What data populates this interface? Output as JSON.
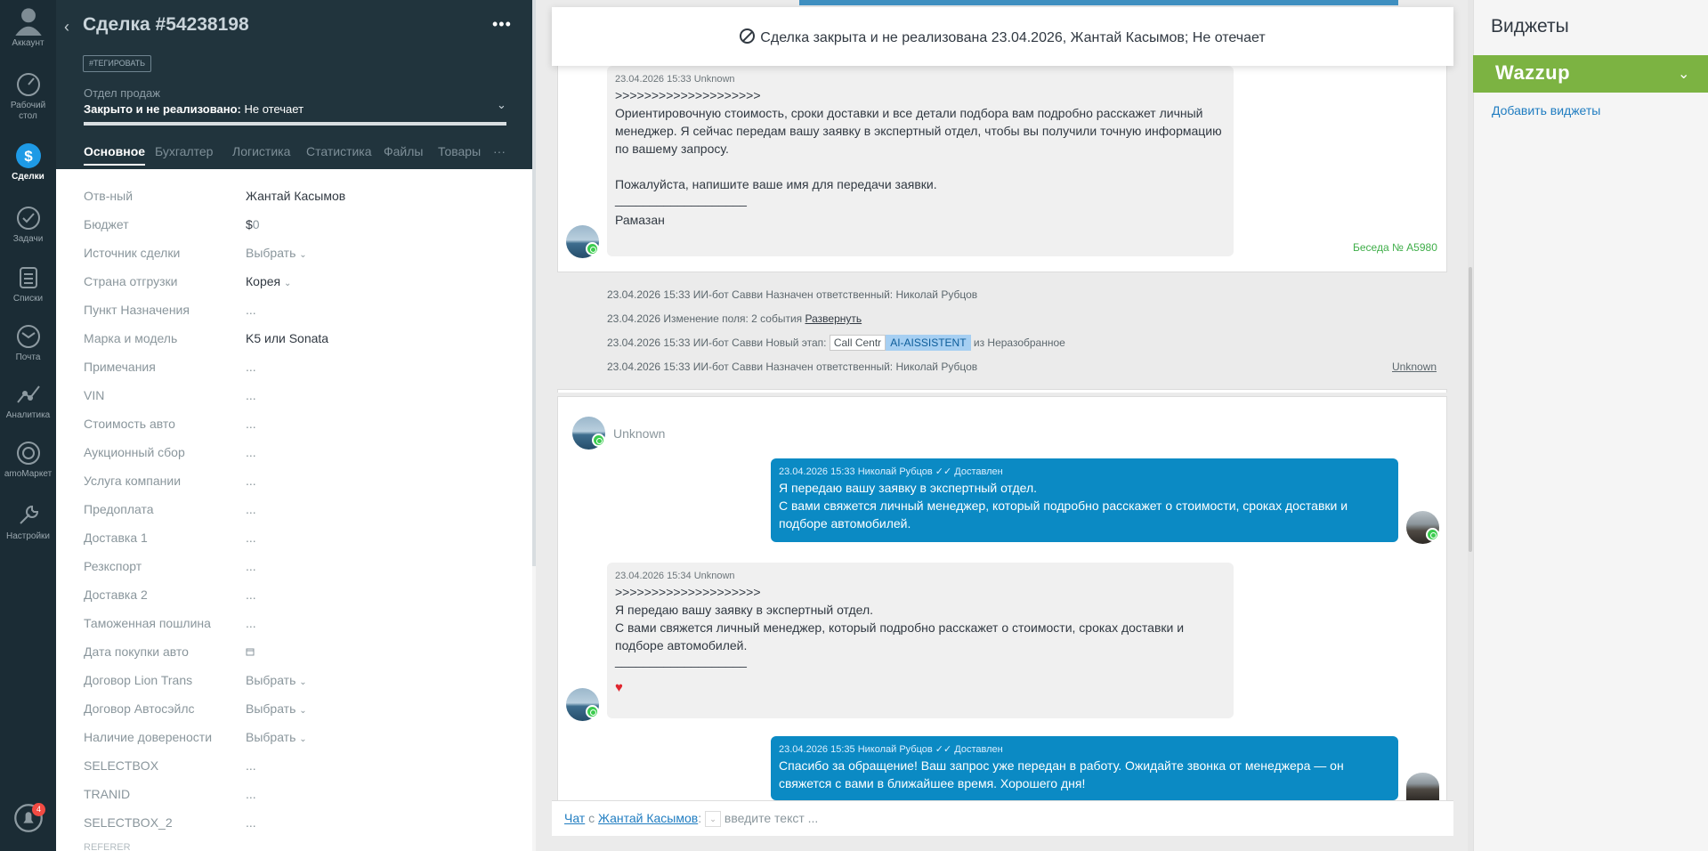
{
  "nav": {
    "items": [
      {
        "label": "Аккаунт",
        "icon": "account-icon"
      },
      {
        "label": "Рабочий стол",
        "icon": "dashboard-icon"
      },
      {
        "label": "Сделки",
        "icon": "deals-icon"
      },
      {
        "label": "Задачи",
        "icon": "tasks-icon"
      },
      {
        "label": "Списки",
        "icon": "lists-icon"
      },
      {
        "label": "Почта",
        "icon": "mail-icon"
      },
      {
        "label": "Аналитика",
        "icon": "analytics-icon"
      },
      {
        "label": "amoМаркет",
        "icon": "market-icon"
      },
      {
        "label": "Настройки",
        "icon": "settings-icon"
      }
    ],
    "notification_count": "4"
  },
  "card": {
    "title": "Сделка #54238198",
    "tag_button": "#ТЕГИРОВАТЬ",
    "pipeline": "Отдел продаж",
    "status_bold": "Закрыто и не реализовано:",
    "status_reason": "Не отечает",
    "tabs": [
      "Основное",
      "Бухгалтер",
      "Логистика",
      "Статистика",
      "Файлы",
      "Товары"
    ],
    "tab_more": "···",
    "fields": [
      {
        "label": "Отв-ный",
        "value": "Жантай Касымов"
      },
      {
        "label": "Бюджет",
        "value": "$",
        "value2": "0"
      },
      {
        "label": "Источник сделки",
        "value": "Выбрать"
      },
      {
        "label": "Страна отгрузки",
        "value": "Корея"
      },
      {
        "label": "Пункт Назначения",
        "value": "..."
      },
      {
        "label": "Марка и модель",
        "value": "K5 или Sonata"
      },
      {
        "label": "Примечания",
        "value": "..."
      },
      {
        "label": "VIN",
        "value": "..."
      },
      {
        "label": "Стоимость авто",
        "value": "..."
      },
      {
        "label": "Аукционный сбор",
        "value": "..."
      },
      {
        "label": "Услуга компании",
        "value": "..."
      },
      {
        "label": "Предоплата",
        "value": "..."
      },
      {
        "label": "Доставка 1",
        "value": "..."
      },
      {
        "label": "Резкспорт",
        "value": "..."
      },
      {
        "label": "Доставка 2",
        "value": "..."
      },
      {
        "label": "Таможенная пошлина",
        "value": "..."
      },
      {
        "label": "Дата покупки авто",
        "value": ""
      },
      {
        "label": "Договор Lion Trans",
        "value": "Выбрать"
      },
      {
        "label": "Договор Автосэйлс",
        "value": "Выбрать"
      },
      {
        "label": "Наличие доверености",
        "value": "Выбрать"
      },
      {
        "label": "SELECTBOX",
        "value": "..."
      },
      {
        "label": "TRANID",
        "value": "..."
      },
      {
        "label": "SELECTBOX_2",
        "value": "..."
      },
      {
        "label": "REFERER",
        "value": ""
      }
    ]
  },
  "feed": {
    "closed_banner": "Сделка закрыта и не реализована 23.04.2026, Жантай Касымов; Не отечает",
    "msg1": {
      "meta": "23.04.2026 15:33 Unknown",
      "arrows": ">>>>>>>>>>>>>>>>>>>>",
      "text1": "Ориентировочную стоимость, сроки доставки и все детали подбора вам подробно расскажет личный менеджер. Я сейчас передам вашу заявку в экспертный отдел, чтобы вы получили точную информацию по вашему запросу.",
      "text2": "Пожалуйста, напишите ваше имя для передачи заявки.",
      "line": "___________________",
      "sign": "Рамазан"
    },
    "conversation_label": "Беседа № А5980",
    "events": [
      {
        "text": "23.04.2026 15:33 ИИ-бот Савви Назначен ответственный: Николай Рубцов"
      },
      {
        "text": "23.04.2026 Изменение поля: 2 события ",
        "link": "Развернуть"
      },
      {
        "text": "23.04.2026 15:33 ИИ-бот Савви Новый этап: ",
        "pill1": "Call Centr",
        "pill2": "AI-AISSISTENT",
        "tail": " из Неразобранное"
      },
      {
        "text": "23.04.2026 15:33 ИИ-бот Савви Назначен ответственный: Николай Рубцов",
        "right": "Unknown"
      }
    ],
    "chat2_header": "Unknown",
    "msg_out1": {
      "meta": "23.04.2026 15:33 Николай Рубцов",
      "status": "Доставлен",
      "line1": "Я передаю вашу заявку в экспертный отдел.",
      "line2": "С вами свяжется личный менеджер, который подробно расскажет о стоимости, сроках доставки и подборе автомобилей."
    },
    "msg_in2": {
      "meta": "23.04.2026 15:34 Unknown",
      "arrows": ">>>>>>>>>>>>>>>>>>>>",
      "line1": "Я передаю вашу заявку в экспертный отдел.",
      "line2": "С вами свяжется личный менеджер, который подробно расскажет о стоимости, сроках доставки и подборе автомобилей.",
      "line": "___________________",
      "reaction": "♥"
    },
    "msg_out2": {
      "meta": "23.04.2026 15:35 Николай Рубцов",
      "status": "Доставлен",
      "text": "Спасибо за обращение! Ваш запрос уже передан в работу. Ожидайте звонка от менеджера — он свяжется с вами в ближайшее время. Хорошего дня!"
    },
    "input": {
      "chat_label": "Чат",
      "with": "с",
      "contact": "Жантай Касымов",
      "colon": ":",
      "placeholder": "введите текст ..."
    }
  },
  "widgets": {
    "title": "Виджеты",
    "wazzup": "Wazzup",
    "add": "Добавить виджеты"
  },
  "colors": {
    "nav_bg": "#1b2c35",
    "card_head_bg": "#21343d",
    "out_bubble": "#0b8ac4",
    "wazzup_green": "#7cb342",
    "link": "#207dc1"
  }
}
